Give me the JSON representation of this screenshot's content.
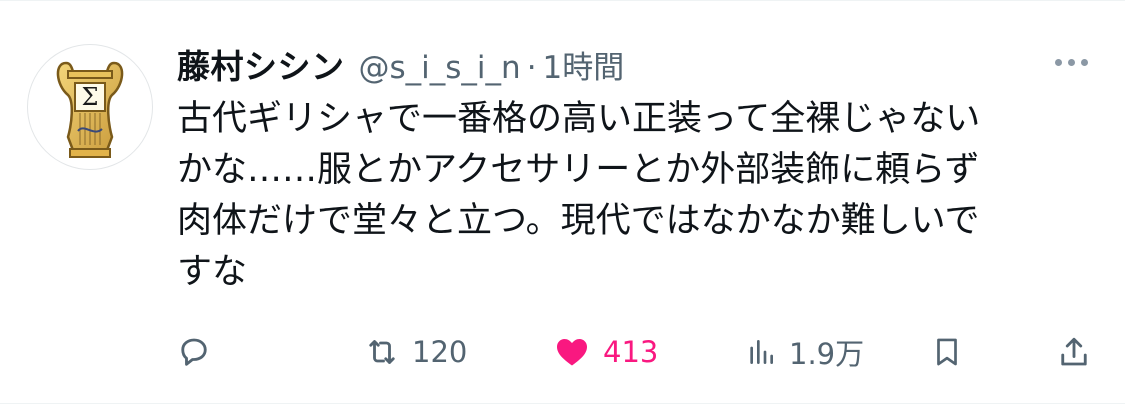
{
  "tweet": {
    "display_name": "藤村シシン",
    "handle": "@s_i_s_i_n",
    "separator": "·",
    "timestamp": "1時間",
    "text": "古代ギリシャで一番格の高い正装って全裸じゃない\nかな……服とかアクセサリーとか外部装飾に頼らず\n肉体だけで堂々と立つ。現代ではなかなか難しいで\nすな"
  },
  "avatar": {
    "glyph": "Σ",
    "icon": "lyre-icon"
  },
  "actions": {
    "reply": {
      "icon": "reply-icon"
    },
    "retweet": {
      "icon": "retweet-icon",
      "count": "120"
    },
    "like": {
      "icon": "heart-icon",
      "count": "413",
      "color": "#f91880",
      "liked": true
    },
    "views": {
      "icon": "views-icon",
      "count": "1.9万"
    },
    "bookmark": {
      "icon": "bookmark-icon"
    },
    "share": {
      "icon": "share-icon"
    }
  },
  "colors": {
    "text": "#0f1419",
    "secondary": "#536471",
    "like": "#f91880",
    "border": "#eff3f4"
  }
}
